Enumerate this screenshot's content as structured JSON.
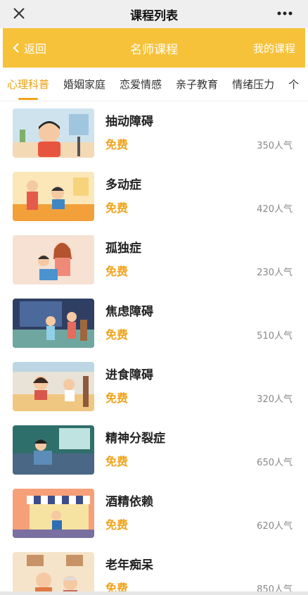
{
  "titlebar": {
    "title": "课程列表",
    "close_icon": "close-icon",
    "more_icon": "more-icon"
  },
  "header": {
    "back_label": "返回",
    "title": "名师课程",
    "my_courses_label": "我的课程",
    "color": "#f6c23a"
  },
  "tabs": [
    {
      "label": "心理科普",
      "active": true
    },
    {
      "label": "婚姻家庭",
      "active": false
    },
    {
      "label": "恋爱情感",
      "active": false
    },
    {
      "label": "亲子教育",
      "active": false
    },
    {
      "label": "情绪压力",
      "active": false
    },
    {
      "label": "个",
      "active": false
    }
  ],
  "courses": [
    {
      "name": "抽动障碍",
      "price": "免费",
      "popularity": "350人气"
    },
    {
      "name": "多动症",
      "price": "免费",
      "popularity": "420人气"
    },
    {
      "name": "孤独症",
      "price": "免费",
      "popularity": "230人气"
    },
    {
      "name": "焦虑障碍",
      "price": "免费",
      "popularity": "510人气"
    },
    {
      "name": "进食障碍",
      "price": "免费",
      "popularity": "320人气"
    },
    {
      "name": "精神分裂症",
      "price": "免费",
      "popularity": "650人气"
    },
    {
      "name": "酒精依赖",
      "price": "免费",
      "popularity": "620人气"
    },
    {
      "name": "老年痴呆",
      "price": "免费",
      "popularity": "850人气"
    }
  ]
}
